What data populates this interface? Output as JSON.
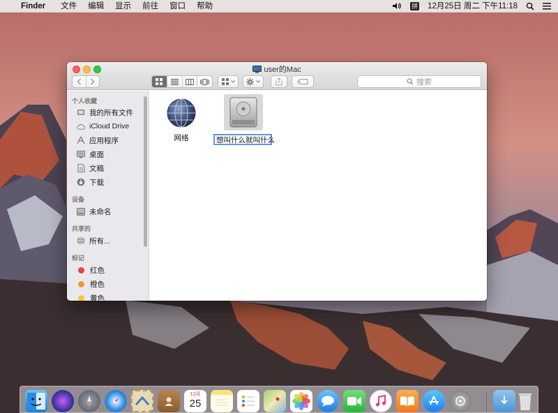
{
  "menubar": {
    "apple_glyph": "",
    "app_name": "Finder",
    "menus": [
      "文件",
      "编辑",
      "显示",
      "前往",
      "窗口",
      "帮助"
    ],
    "status": {
      "input_method": "拼",
      "datetime": "12月25日 周二 下午11:18"
    }
  },
  "window": {
    "title": "user的Mac",
    "search_placeholder": "搜索",
    "view_modes": [
      "icon-view",
      "list-view",
      "column-view",
      "cover-flow-view"
    ],
    "active_view": "icon-view"
  },
  "sidebar": {
    "sections": [
      {
        "heading": "个人收藏",
        "items": [
          {
            "label": "我的所有文件",
            "icon": "all-files-icon"
          },
          {
            "label": "iCloud Drive",
            "icon": "cloud-icon"
          },
          {
            "label": "应用程序",
            "icon": "applications-icon"
          },
          {
            "label": "桌面",
            "icon": "desktop-icon"
          },
          {
            "label": "文稿",
            "icon": "documents-icon"
          },
          {
            "label": "下载",
            "icon": "downloads-icon"
          }
        ]
      },
      {
        "heading": "设备",
        "items": [
          {
            "label": "未命名",
            "icon": "disk-icon"
          }
        ]
      },
      {
        "heading": "共享的",
        "items": [
          {
            "label": "所有...",
            "icon": "network-icon"
          }
        ]
      },
      {
        "heading": "标记",
        "items": [
          {
            "label": "红色",
            "color": "#e8453c"
          },
          {
            "label": "橙色",
            "color": "#f39a2b"
          },
          {
            "label": "黄色",
            "color": "#f2cc30"
          }
        ]
      }
    ]
  },
  "content": {
    "items": [
      {
        "label": "网络",
        "icon": "network-globe-icon"
      },
      {
        "label": "想叫什么就叫什么",
        "icon": "hard-drive-icon",
        "renaming": true
      }
    ]
  },
  "dock": {
    "calendar": {
      "month": "12月",
      "day": "25"
    },
    "apps": [
      "finder",
      "siri",
      "launchpad",
      "safari",
      "mail-stamp",
      "contacts",
      "calendar",
      "notes",
      "reminders",
      "maps",
      "photos",
      "messages",
      "facetime",
      "itunes",
      "ibooks",
      "app-store",
      "system-preferences",
      "downloads",
      "trash"
    ]
  },
  "colors": {
    "accent": "#5d97dd",
    "close": "#fc605c",
    "minimize": "#fdbc40",
    "zoom": "#34c84a"
  }
}
